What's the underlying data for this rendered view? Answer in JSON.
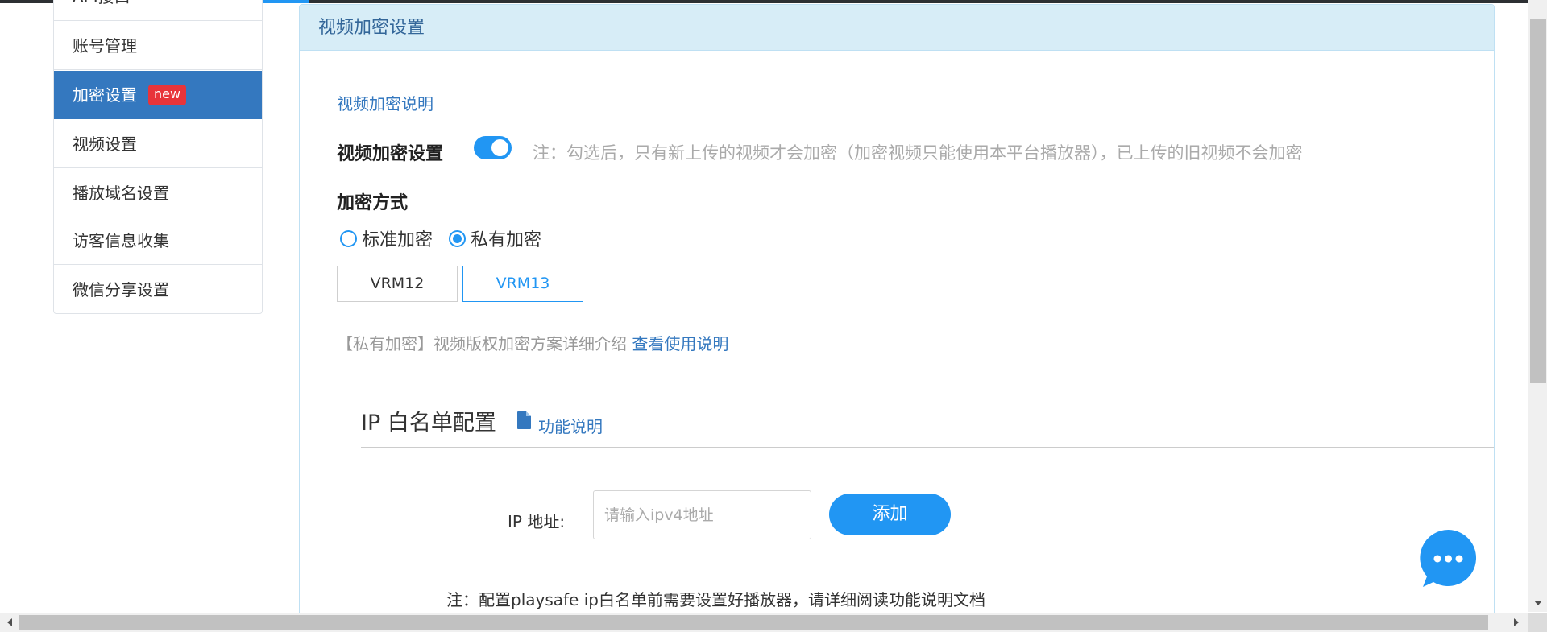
{
  "sidebar": {
    "cut_item_label": "API接口",
    "items": [
      {
        "label": "账号管理"
      },
      {
        "label": "加密设置",
        "badge": "new"
      },
      {
        "label": "视频设置"
      },
      {
        "label": "播放域名设置"
      },
      {
        "label": "访客信息收集"
      },
      {
        "label": "微信分享设置"
      }
    ]
  },
  "panel": {
    "title": "视频加密设置",
    "description_link": "视频加密说明",
    "encrypt_label": "视频加密设置",
    "encrypt_toggle_on": true,
    "encrypt_note": "注：勾选后，只有新上传的视频才会加密（加密视频只能使用本平台播放器），已上传的旧视频不会加密",
    "method_label": "加密方式",
    "methods": [
      {
        "label": "标准加密",
        "checked": false
      },
      {
        "label": "私有加密",
        "checked": true
      }
    ],
    "versions": [
      {
        "label": "VRM12",
        "selected": false
      },
      {
        "label": "VRM13",
        "selected": true
      }
    ],
    "private_desc": "【私有加密】视频版权加密方案详细介绍",
    "private_desc_link": "查看使用说明"
  },
  "ip_whitelist": {
    "title": "IP 白名单配置",
    "func_link": "功能说明",
    "ip_label": "IP 地址:",
    "ip_placeholder": "请输入ipv4地址",
    "ip_value": "",
    "add_button": "添加",
    "note": "注：配置playsafe ip白名单前需要设置好播放器，请详细阅读功能说明文档"
  },
  "colors": {
    "accent": "#2196f3",
    "sidebar_active": "#3478bf",
    "header_bg": "#d7edf7",
    "badge": "#e8343a"
  },
  "icons": {
    "doc": "document-icon",
    "chat": "chat-bubble-icon"
  }
}
